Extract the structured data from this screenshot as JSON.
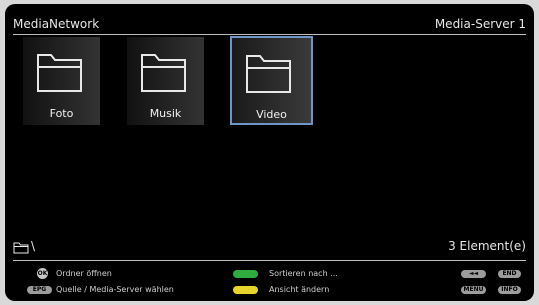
{
  "header": {
    "title": "MediaNetwork",
    "server": "Media-Server 1"
  },
  "folders": [
    {
      "label": "Foto"
    },
    {
      "label": "Musik"
    },
    {
      "label": "Video"
    }
  ],
  "footer": {
    "path": "\\",
    "count": "3 Element(e)"
  },
  "help": {
    "ok_key": "OK",
    "ok_text": "Ordner öffnen",
    "epg_key": "EPG",
    "epg_text": "Quelle / Media-Server wählen",
    "green_text": "Sortieren nach ...",
    "yellow_text": "Ansicht ändern",
    "rewind_key": "◄◄",
    "end_key": "END",
    "menu_key": "MENU",
    "info_key": "INFO"
  },
  "colors": {
    "selection_border": "#6e95c8",
    "green_key": "#2fae3f",
    "yellow_key": "#e8d52b"
  }
}
